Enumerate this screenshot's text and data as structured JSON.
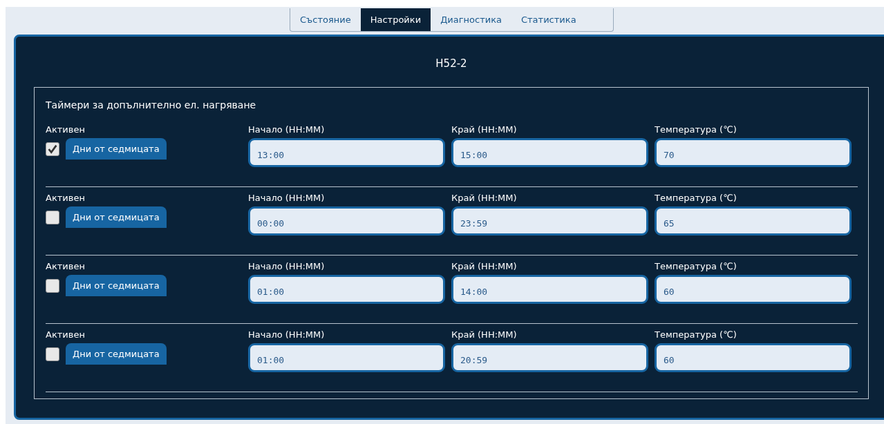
{
  "tabs": [
    {
      "label": "Състояние",
      "selected": false
    },
    {
      "label": "Настройки",
      "selected": true
    },
    {
      "label": "Диагностика",
      "selected": false
    },
    {
      "label": "Статистика",
      "selected": false
    }
  ],
  "panel": {
    "title": "H52-2",
    "section_title": "Таймери за допълнително ел. нагряване",
    "timers": [
      {
        "active_label": "Активен",
        "active": true,
        "days_button": "Дни от седмицата",
        "start_label": "Начало (HH:MM)",
        "start": "13:00",
        "end_label": "Край (HH:MM)",
        "end": "15:00",
        "temp_label": "Температура (℃)",
        "temp": "70"
      },
      {
        "active_label": "Активен",
        "active": false,
        "days_button": "Дни от седмицата",
        "start_label": "Начало (HH:MM)",
        "start": "00:00",
        "end_label": "Край (HH:MM)",
        "end": "23:59",
        "temp_label": "Температура (℃)",
        "temp": "65"
      },
      {
        "active_label": "Активен",
        "active": false,
        "days_button": "Дни от седмицата",
        "start_label": "Начало (HH:MM)",
        "start": "01:00",
        "end_label": "Край (HH:MM)",
        "end": "14:00",
        "temp_label": "Температура (℃)",
        "temp": "60"
      },
      {
        "active_label": "Активен",
        "active": false,
        "days_button": "Дни от седмицата",
        "start_label": "Начало (HH:MM)",
        "start": "01:00",
        "end_label": "Край (HH:MM)",
        "end": "20:59",
        "temp_label": "Температура (℃)",
        "temp": "60"
      }
    ]
  }
}
